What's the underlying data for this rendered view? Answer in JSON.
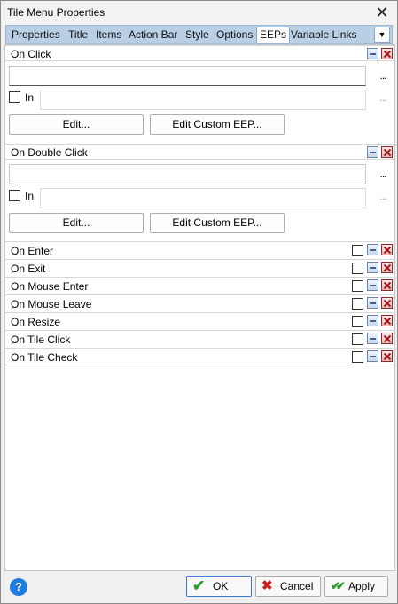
{
  "window": {
    "title": "Tile Menu Properties",
    "close_glyph": "✕"
  },
  "tabs": [
    {
      "label": "Properties"
    },
    {
      "label": "Title"
    },
    {
      "label": "Items"
    },
    {
      "label": "Action Bar"
    },
    {
      "label": "Style"
    },
    {
      "label": "Options"
    },
    {
      "label": "EEPs",
      "active": true
    },
    {
      "label": "Variable Links"
    }
  ],
  "tab_dropdown_glyph": "▼",
  "sections": [
    {
      "label": "On Click",
      "in_label": "In",
      "ellipsis": "...",
      "edit_label": "Edit...",
      "edit_custom_label": "Edit Custom EEP..."
    },
    {
      "label": "On Double Click",
      "in_label": "In",
      "ellipsis": "...",
      "edit_label": "Edit...",
      "edit_custom_label": "Edit Custom EEP..."
    }
  ],
  "events": [
    {
      "label": "On Enter"
    },
    {
      "label": "On Exit"
    },
    {
      "label": "On Mouse Enter"
    },
    {
      "label": "On Mouse Leave"
    },
    {
      "label": "On Resize"
    },
    {
      "label": "On Tile Click"
    },
    {
      "label": "On Tile Check"
    }
  ],
  "footer": {
    "help_glyph": "?",
    "ok_label": "OK",
    "cancel_label": "Cancel",
    "apply_label": "Apply",
    "ok_glyph": "✔",
    "cancel_glyph": "✖",
    "apply_glyph": "✔✔"
  },
  "colors": {
    "tabbar": "#b9cfe6",
    "accent": "#1e7be0",
    "ok_check": "#2e9b2e",
    "cancel_x": "#cc1f1f"
  }
}
